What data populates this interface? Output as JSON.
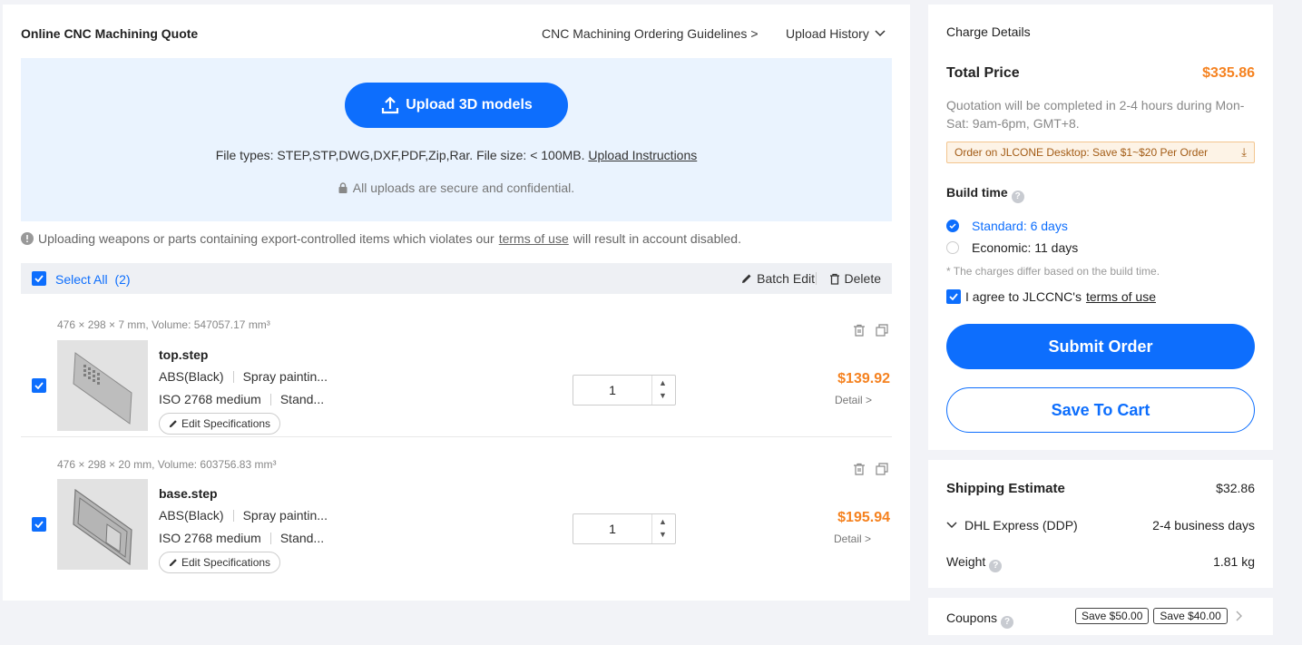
{
  "header": {
    "title": "Online CNC Machining Quote",
    "guidelines_link": "CNC Machining Ordering Guidelines >",
    "upload_history": "Upload History"
  },
  "upload": {
    "button_label": "Upload 3D models",
    "file_types": "File types: STEP,STP,DWG,DXF,PDF,Zip,Rar. File size: < 100MB.",
    "instructions_link": "Upload Instructions",
    "secure_text": "All uploads are secure and confidential."
  },
  "warning": {
    "text_before": "Uploading weapons or parts containing export-controlled items which violates our",
    "terms_link": "terms of use",
    "text_after": "will result in account disabled."
  },
  "selection": {
    "select_all_label": "Select All",
    "count": "(2)",
    "batch_edit": "Batch Edit",
    "delete": "Delete"
  },
  "parts": [
    {
      "dims": "476 × 298 × 7 mm, Volume: 547057.17 mm³",
      "name": "top.step",
      "material": "ABS(Black)",
      "finish": "Spray paintin...",
      "tolerance": "ISO 2768 medium",
      "surface": "Stand...",
      "edit_label": "Edit Specifications",
      "quantity": "1",
      "price": "$139.92",
      "detail": "Detail >"
    },
    {
      "dims": "476 × 298 × 20 mm, Volume: 603756.83 mm³",
      "name": "base.step",
      "material": "ABS(Black)",
      "finish": "Spray paintin...",
      "tolerance": "ISO 2768 medium",
      "surface": "Stand...",
      "edit_label": "Edit Specifications",
      "quantity": "1",
      "price": "$195.94",
      "detail": "Detail >"
    }
  ],
  "charge": {
    "heading": "Charge Details",
    "total_label": "Total Price",
    "total_value": "$335.86",
    "quote_note": "Quotation will be completed in 2-4 hours during Mon-Sat: 9am-6pm, GMT+8.",
    "promo": "Order on JLCONE Desktop: Save $1~$20 Per Order",
    "build_time_label": "Build time",
    "options": [
      {
        "label": "Standard: 6 days",
        "selected": true
      },
      {
        "label": "Economic: 11 days",
        "selected": false
      }
    ],
    "build_note": "* The charges differ based on the build time.",
    "agree_text": "I agree to JLCCNC's",
    "agree_link": "terms of use",
    "submit_label": "Submit Order",
    "cart_label": "Save To Cart"
  },
  "shipping": {
    "label": "Shipping Estimate",
    "value": "$32.86",
    "carrier": "DHL Express (DDP)",
    "carrier_time": "2-4 business days",
    "weight_label": "Weight",
    "weight_value": "1.81 kg"
  },
  "coupons": {
    "label": "Coupons",
    "tags": [
      "Save $50.00",
      "Save $40.00"
    ]
  },
  "colors": {
    "accent": "#0d6efd",
    "price": "#f58220",
    "upload_bg": "#eaf3fe"
  }
}
